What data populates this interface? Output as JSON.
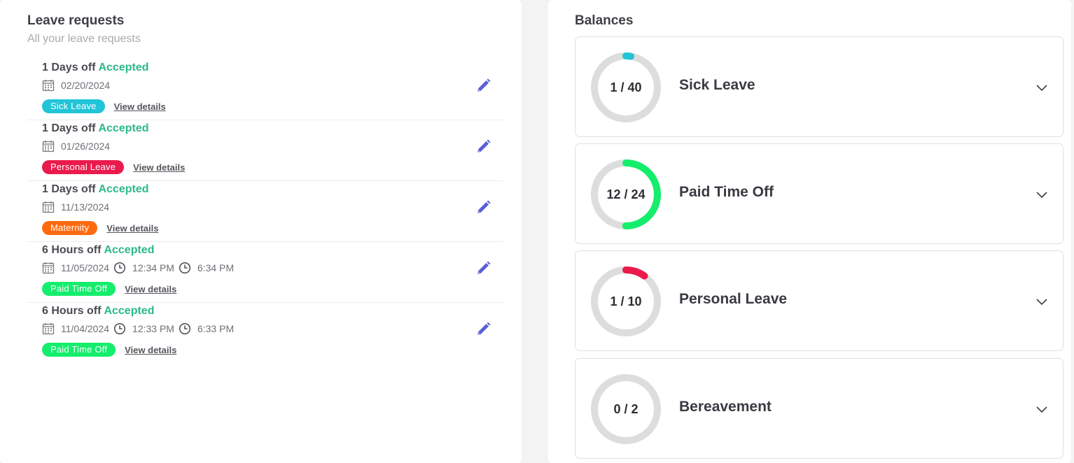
{
  "leave_requests": {
    "title": "Leave requests",
    "subtitle": "All your leave requests",
    "items": [
      {
        "duration": "1 Days off",
        "status": "Accepted",
        "date": "02/20/2024",
        "start_time": "",
        "end_time": "",
        "type": "Sick Leave",
        "type_color": "#22c4d8",
        "view_label": "View details"
      },
      {
        "duration": "1 Days off",
        "status": "Accepted",
        "date": "01/26/2024",
        "start_time": "",
        "end_time": "",
        "type": "Personal Leave",
        "type_color": "#ea1a4c",
        "view_label": "View details"
      },
      {
        "duration": "1 Days off",
        "status": "Accepted",
        "date": "11/13/2024",
        "start_time": "",
        "end_time": "",
        "type": "Maternity",
        "type_color": "#ff6a0f",
        "view_label": "View details"
      },
      {
        "duration": "6 Hours off",
        "status": "Accepted",
        "date": "11/05/2024",
        "start_time": "12:34 PM",
        "end_time": "6:34 PM",
        "type": "Paid Time Off",
        "type_color": "#14ee6c",
        "view_label": "View details"
      },
      {
        "duration": "6 Hours off",
        "status": "Accepted",
        "date": "11/04/2024",
        "start_time": "12:33 PM",
        "end_time": "6:33 PM",
        "type": "Paid Time Off",
        "type_color": "#14ee6c",
        "view_label": "View details"
      }
    ]
  },
  "balances": {
    "title": "Balances",
    "items": [
      {
        "used": 1,
        "total": 40,
        "label": "1 / 40",
        "name": "Sick Leave",
        "color": "#22c4d8"
      },
      {
        "used": 12,
        "total": 24,
        "label": "12 / 24",
        "name": "Paid Time Off",
        "color": "#14ee6c"
      },
      {
        "used": 1,
        "total": 10,
        "label": "1 / 10",
        "name": "Personal Leave",
        "color": "#ea1a4c"
      },
      {
        "used": 0,
        "total": 2,
        "label": "0 / 2",
        "name": "Bereavement",
        "color": "#cccccc"
      }
    ]
  },
  "colors": {
    "accepted": "#2bb98a",
    "edit_icon": "#5a5fd6",
    "ring_track": "#dddddd"
  },
  "icons": {
    "date": "calendar-icon",
    "time": "clock-icon",
    "edit": "pencil-icon",
    "expand": "chevron-down-icon"
  }
}
